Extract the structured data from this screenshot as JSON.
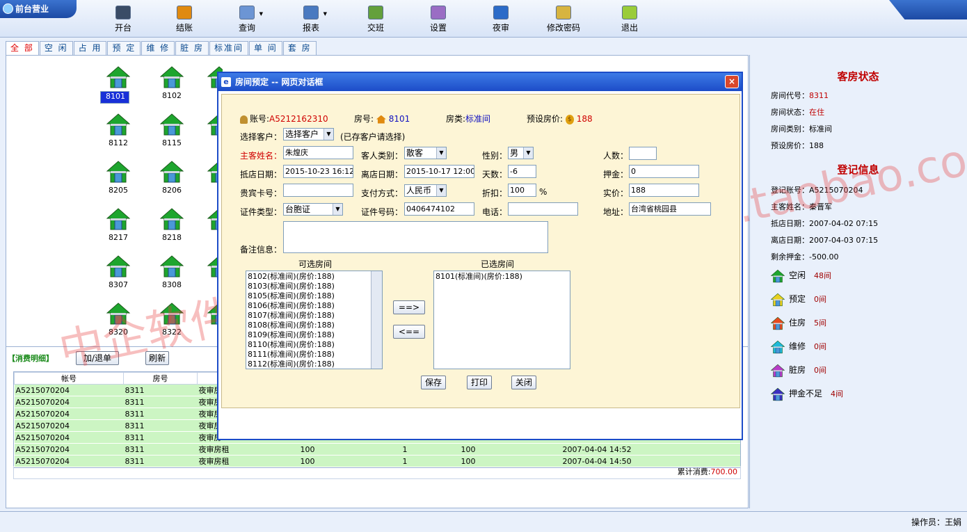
{
  "app": {
    "title": "前台营业"
  },
  "toolbar": [
    {
      "label": "开台",
      "icon": "open-table-icon",
      "color": "#3a4c66"
    },
    {
      "label": "结账",
      "icon": "checkout-icon",
      "color": "#e08a10"
    },
    {
      "label": "查询",
      "icon": "query-icon",
      "color": "#6c95d4"
    },
    {
      "label": "报表",
      "icon": "report-icon",
      "color": "#4a7ac0"
    },
    {
      "label": "交班",
      "icon": "shift-change-icon",
      "color": "#64a03c"
    },
    {
      "label": "设置",
      "icon": "settings-icon",
      "color": "#9a6dc4"
    },
    {
      "label": "夜审",
      "icon": "night-audit-icon",
      "color": "#2b6bc8"
    },
    {
      "label": "修改密码",
      "icon": "change-password-icon",
      "color": "#d7b440"
    },
    {
      "label": "退出",
      "icon": "exit-icon",
      "color": "#9acc3a"
    }
  ],
  "tabs": [
    "全 部",
    "空 闲",
    "占 用",
    "预 定",
    "维 修",
    "脏 房",
    "标准间",
    "单 间",
    "套 房"
  ],
  "rooms": [
    "8101",
    "8102",
    "8112",
    "8115",
    "8205",
    "8206",
    "8217",
    "8218",
    "8307",
    "8308",
    "8320",
    "8322"
  ],
  "consumption": {
    "title": "【消费明细】",
    "add_btn": "加/退单",
    "refresh_btn": "刷新",
    "headers": [
      "帐号",
      "房号"
    ],
    "rows": [
      [
        "A5215070204",
        "8311",
        "夜审房",
        "",
        "",
        "",
        "",
        ""
      ],
      [
        "A5215070204",
        "8311",
        "夜审房",
        "",
        "",
        "",
        "",
        ""
      ],
      [
        "A5215070204",
        "8311",
        "夜审房",
        "",
        "",
        "",
        "",
        ""
      ],
      [
        "A5215070204",
        "8311",
        "夜审房",
        "",
        "",
        "",
        "",
        ""
      ],
      [
        "A5215070204",
        "8311",
        "夜审房",
        "",
        "",
        "",
        "",
        ""
      ],
      [
        "A5215070204",
        "8311",
        "夜审房租",
        "100",
        "1",
        "100",
        "2007-04-04 14:52"
      ],
      [
        "A5215070204",
        "8311",
        "夜审房租",
        "100",
        "1",
        "100",
        "2007-04-04 14:50"
      ]
    ],
    "total_label": "累计消费:",
    "total_value": "700.00"
  },
  "room_status": {
    "title": "客房状态",
    "code_label": "房间代号：",
    "code": "8311",
    "state_label": "房间状态：",
    "state": "在住",
    "type_label": "房间类别：",
    "type": "标准间",
    "price_label": "预设房价：",
    "price": "188"
  },
  "registration": {
    "title": "登记信息",
    "acct_label": "登记账号：",
    "acct": "A5215070204",
    "guest_label": "主客姓名：",
    "guest": "秦晋军",
    "in_label": "抵店日期：",
    "in": "2007-04-02 07:15",
    "out_label": "离店日期：",
    "out": "2007-04-03 07:15",
    "deposit_label": "剩余押金：",
    "deposit": "-500.00"
  },
  "legend": [
    {
      "label": "空闲",
      "count": "48间",
      "color": "#1ea52e"
    },
    {
      "label": "预定",
      "count": "0间",
      "color": "#e8d020"
    },
    {
      "label": "住房",
      "count": "5间",
      "color": "#e84a1e"
    },
    {
      "label": "维修",
      "count": "0间",
      "color": "#1fb9d8"
    },
    {
      "label": "脏房",
      "count": "0间",
      "color": "#b83cc8"
    },
    {
      "label": "押金不足",
      "count": "4间",
      "color": "#3a2fc0"
    }
  ],
  "status": {
    "operator": "操作员：王娟"
  },
  "dialog": {
    "title": "房间预定 -- 网页对话框",
    "acct_label": "账号:",
    "acct": "A5212162310",
    "room_label": "房号:",
    "room": "8101",
    "rtype_label": "房类:",
    "rtype": "标准间",
    "price_label": "预设房价:",
    "price": "188",
    "select_guest_label": "选择客户：",
    "select_guest": "选择客户",
    "select_hint": "(已存客户请选择)",
    "guest_name_label": "主客姓名：",
    "guest_name": "朱煌庆",
    "guest_type_label": "客人类别：",
    "guest_type": "散客",
    "gender_label": "性别：",
    "gender": "男",
    "people_label": "人数：",
    "people": "",
    "checkin_label": "抵店日期：",
    "checkin": "2015-10-23 16:12",
    "checkout_label": "离店日期：",
    "checkout": "2015-10-17 12:00",
    "days_label": "天数：",
    "days": "-6",
    "deposit_label": "押金：",
    "deposit": "0",
    "vip_label": "贵宾卡号：",
    "vip": "",
    "pay_label": "支付方式：",
    "pay": "人民币",
    "discount_label": "折扣：",
    "discount": "100",
    "pct": "%",
    "actual_label": "实价：",
    "actual": "188",
    "idtype_label": "证件类型：",
    "idtype": "台胞证",
    "idno_label": "证件号码：",
    "idno": "0406474102",
    "phone_label": "电话：",
    "phone": "",
    "addr_label": "地址：",
    "addr": "台湾省桃园县",
    "note_label": "备注信息：",
    "note": "",
    "avail_label": "可选房间",
    "chosen_label": "已选房间",
    "avail": [
      "8102(标准间)(房价:188)",
      "8103(标准间)(房价:188)",
      "8105(标准间)(房价:188)",
      "8106(标准间)(房价:188)",
      "8107(标准间)(房价:188)",
      "8108(标准间)(房价:188)",
      "8109(标准间)(房价:188)",
      "8110(标准间)(房价:188)",
      "8111(标准间)(房价:188)",
      "8112(标准间)(房价:188)"
    ],
    "chosen": [
      "8101(标准间)(房价:188)"
    ],
    "add_btn": "==>",
    "remove_btn": "<==",
    "save_btn": "保存",
    "print_btn": "打印",
    "close_btn": "关闭"
  },
  "watermark": {
    "text": "中企软件-http://shop113983775.taobao.com"
  }
}
